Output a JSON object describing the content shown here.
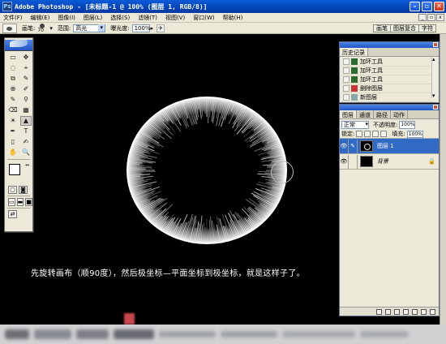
{
  "window": {
    "title": "Adobe Photoshop - [未标题-1 @ 100% (图层 1, RGB/8)]",
    "app_icon": "Ps"
  },
  "menu": [
    "文件(F)",
    "编辑(E)",
    "图像(I)",
    "图层(L)",
    "选择(S)",
    "滤镜(T)",
    "视图(V)",
    "窗口(W)",
    "帮助(H)"
  ],
  "options": {
    "brush_label": "画笔:",
    "brush_size": "70",
    "range_label": "范围:",
    "range_value": "高光",
    "exposure_label": "曝光度:",
    "exposure_value": "100%",
    "palette_tabs": [
      "画笔",
      "图层复合",
      "字符"
    ]
  },
  "toolbox": {
    "tools": [
      [
        "▭",
        "✥"
      ],
      [
        "◌",
        "⌖"
      ],
      [
        "⧉",
        "✎"
      ],
      [
        "⊕",
        "✐"
      ],
      [
        "✎",
        "⚲"
      ],
      [
        "⌫",
        "▦"
      ],
      [
        "☀",
        "▲"
      ],
      [
        "✒",
        "T"
      ],
      [
        "▯",
        "✍"
      ],
      [
        "✋",
        "🔍"
      ]
    ]
  },
  "canvas": {
    "caption": "先旋转画布（顺90度），然后极坐标—平面坐标到极坐标，就是这样子了。"
  },
  "history": {
    "tab": "历史记录",
    "items": [
      "加环工具",
      "加环工具",
      "加环工具",
      "删除图层",
      "新图层"
    ]
  },
  "layers": {
    "tabs": [
      "图层",
      "通道",
      "路径",
      "动作"
    ],
    "blend_mode": "正常",
    "opacity_label": "不透明度:",
    "opacity_value": "100%",
    "lock_label": "锁定:",
    "fill_label": "填充:",
    "fill_value": "100%",
    "items": [
      {
        "name": "图层 1",
        "selected": true
      },
      {
        "name": "背景",
        "selected": false
      }
    ]
  }
}
